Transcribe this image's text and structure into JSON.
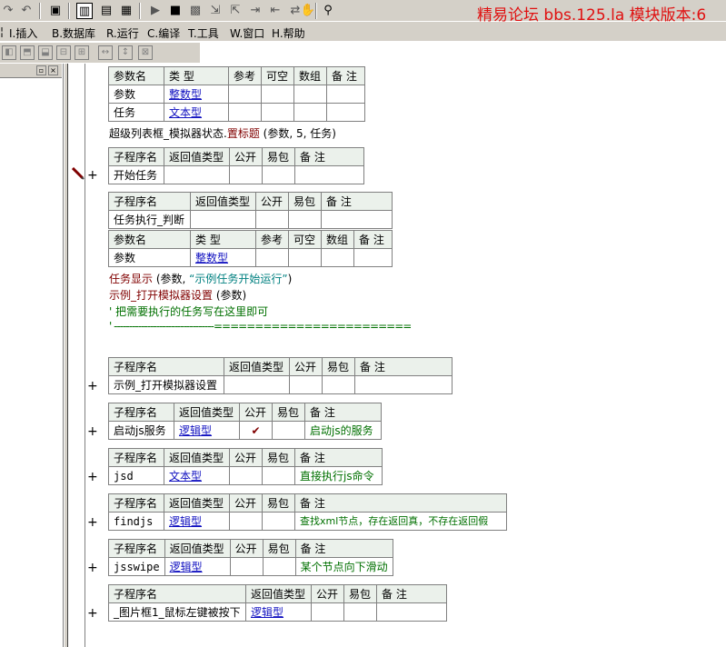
{
  "forum_banner": "精易论坛 bbs.125.la 模块版本:6",
  "menu": {
    "items": [
      "I.插入",
      "B.数据库",
      "R.运行",
      "C.编译",
      "T.工具",
      "W.窗口",
      "H.帮助"
    ]
  },
  "tables": {
    "params1": {
      "headers": [
        "参数名",
        "类 型",
        "参考",
        "可空",
        "数组",
        "备 注"
      ],
      "rows": [
        [
          "参数",
          "整数型"
        ],
        [
          "任务",
          "文本型"
        ]
      ]
    },
    "sub_start": {
      "headers": [
        "子程序名",
        "返回值类型",
        "公开",
        "易包",
        "备 注"
      ],
      "name": "开始任务"
    },
    "sub_judge": {
      "headers": [
        "子程序名",
        "返回值类型",
        "公开",
        "易包",
        "备 注"
      ],
      "name": "任务执行_判断"
    },
    "params2": {
      "headers": [
        "参数名",
        "类 型",
        "参考",
        "可空",
        "数组",
        "备 注"
      ],
      "rows": [
        [
          "参数",
          "整数型"
        ]
      ]
    },
    "sub_open": {
      "headers": [
        "子程序名",
        "返回值类型",
        "公开",
        "易包",
        "备 注"
      ],
      "name": "示例_打开模拟器设置"
    },
    "sub_js": {
      "headers": [
        "子程序名",
        "返回值类型",
        "公开",
        "易包",
        "备 注"
      ],
      "name": "启动js服务",
      "ret": "逻辑型",
      "note": "启动js的服务"
    },
    "sub_jsd": {
      "headers": [
        "子程序名",
        "返回值类型",
        "公开",
        "易包",
        "备 注"
      ],
      "name": "jsd",
      "ret": "文本型",
      "note": "直接执行js命令"
    },
    "sub_findjs": {
      "headers": [
        "子程序名",
        "返回值类型",
        "公开",
        "易包",
        "备 注"
      ],
      "name": "findjs",
      "ret": "逻辑型",
      "note": "查找xml节点，存在返回真，不存在返回假"
    },
    "sub_jsswipe": {
      "headers": [
        "子程序名",
        "返回值类型",
        "公开",
        "易包",
        "备 注"
      ],
      "name": "jsswipe",
      "ret": "逻辑型",
      "note": "某个节点向下滑动"
    },
    "sub_pic": {
      "headers": [
        "子程序名",
        "返回值类型",
        "公开",
        "易包",
        "备 注"
      ],
      "name": "_图片框1_鼠标左键被按下",
      "ret": "逻辑型"
    }
  },
  "code": {
    "line1_a": "超级列表框_模拟器状态.",
    "line1_b": "置标题",
    "line1_c": " (参数, 5, 任务)",
    "line2_a": "任务显示",
    "line2_b": " (参数, ",
    "line2_c": "“示例任务开始运行”",
    "line2_d": ")",
    "line3_a": "示例_打开模拟器设置",
    "line3_b": " (参数)",
    "line4": "' 把需要执行的任务写在这里即可",
    "line5": "' ---------------------------------========================"
  },
  "check_mark": "✔",
  "plus": "+"
}
